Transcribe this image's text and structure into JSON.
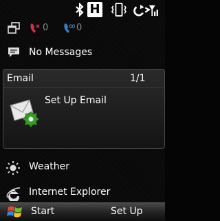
{
  "status_bar": {
    "icons": [
      "bluetooth-icon",
      "hsdpa-icon",
      "vibrate-icon",
      "signal-icon"
    ],
    "hsdpa_label": "H"
  },
  "calls": {
    "missed_calls": "0",
    "voicemail": "0",
    "icons": [
      "windows-icon",
      "missed-call-icon",
      "voicemail-icon"
    ]
  },
  "messages": {
    "label": "No Messages",
    "icon": "message-icon"
  },
  "email": {
    "title": "Email",
    "count": "1/1",
    "setup_label": "Set Up Email",
    "icon": "email-setup-icon"
  },
  "weather": {
    "label": "Weather",
    "icon": "sun-icon"
  },
  "internet": {
    "label": "Internet Explorer",
    "icon": "ie-icon"
  },
  "taskbar": {
    "start_label": "Start",
    "right_label": "Set Up",
    "start_icon": "windows-flag-icon"
  }
}
